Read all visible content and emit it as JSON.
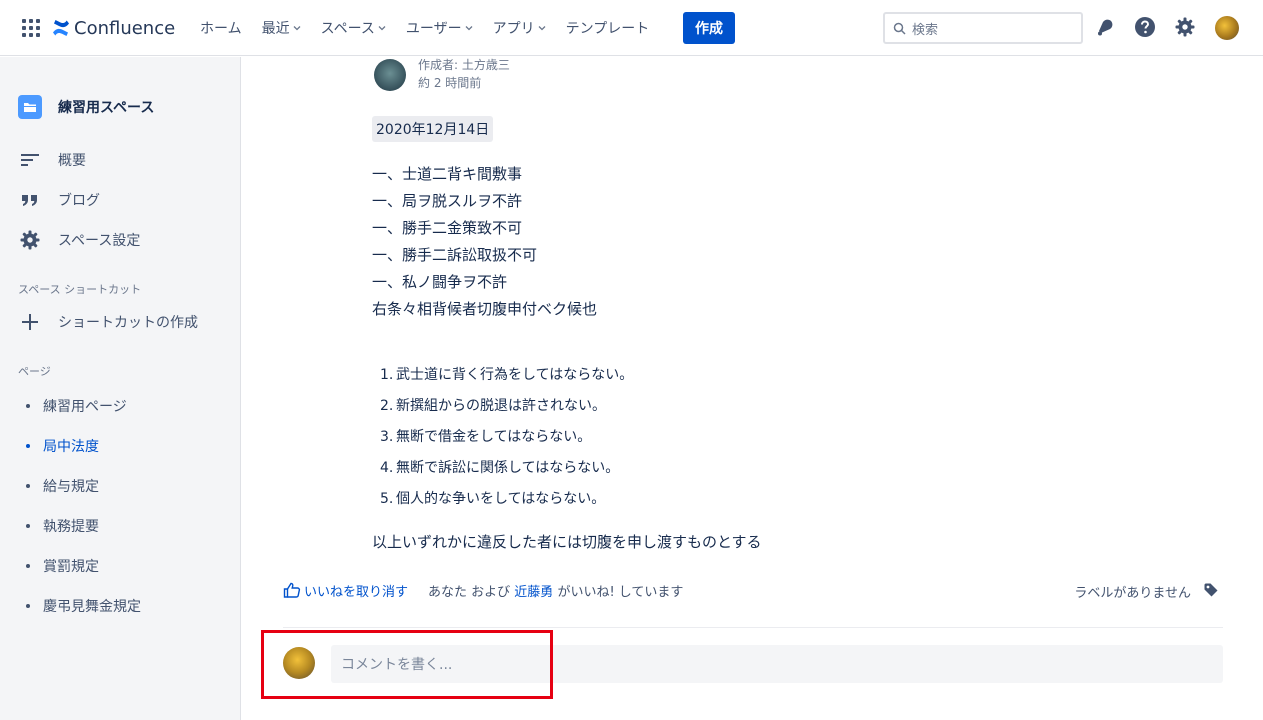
{
  "app": {
    "name": "Confluence"
  },
  "topnav": {
    "items": [
      {
        "label": "ホーム",
        "dropdown": false
      },
      {
        "label": "最近",
        "dropdown": true
      },
      {
        "label": "スペース",
        "dropdown": true
      },
      {
        "label": "ユーザー",
        "dropdown": true
      },
      {
        "label": "アプリ",
        "dropdown": true
      },
      {
        "label": "テンプレート",
        "dropdown": false
      }
    ],
    "create_label": "作成",
    "search_placeholder": "検索"
  },
  "sidebar": {
    "space_name": "練習用スペース",
    "items": [
      {
        "label": "概要",
        "icon": "overview-icon"
      },
      {
        "label": "ブログ",
        "icon": "quote-icon"
      },
      {
        "label": "スペース設定",
        "icon": "gear-icon"
      }
    ],
    "shortcuts_heading": "スペース ショートカット",
    "create_shortcut_label": "ショートカットの作成",
    "pages_heading": "ページ",
    "pages": [
      {
        "label": "練習用ページ",
        "active": false
      },
      {
        "label": "局中法度",
        "active": true
      },
      {
        "label": "給与規定",
        "active": false
      },
      {
        "label": "執務提要",
        "active": false
      },
      {
        "label": "賞罰規定",
        "active": false
      },
      {
        "label": "慶弔見舞金規定",
        "active": false
      }
    ]
  },
  "page": {
    "author_line": "作成者: 土方歳三",
    "time_line": "約 2 時間前",
    "date": "2020年12月14日",
    "lines": [
      "一、士道二背キ間敷事",
      "一、局ヲ脱スルヲ不許",
      "一、勝手二金策致不可",
      "一、勝手二訴訟取扱不可",
      "一、私ノ闘争ヲ不許",
      "右条々相背候者切腹申付ベク候也"
    ],
    "list": [
      "武士道に背く行為をしてはならない。",
      "新撰組からの脱退は許されない。",
      "無断で借金をしてはならない。",
      "無断で訴訟に関係してはならない。",
      "個人的な争いをしてはならない。"
    ],
    "closing": "以上いずれかに違反した者には切腹を申し渡すものとする"
  },
  "likes": {
    "unlike_label": "いいねを取り消す",
    "prefix": "あなた および",
    "who": "近藤勇",
    "suffix": "がいいね! しています",
    "no_labels": "ラベルがありません"
  },
  "comment": {
    "placeholder": "コメントを書く..."
  },
  "colors": {
    "brand": "#0052cc",
    "highlight": "#e60012",
    "sidebar_bg": "#f4f5f7"
  }
}
